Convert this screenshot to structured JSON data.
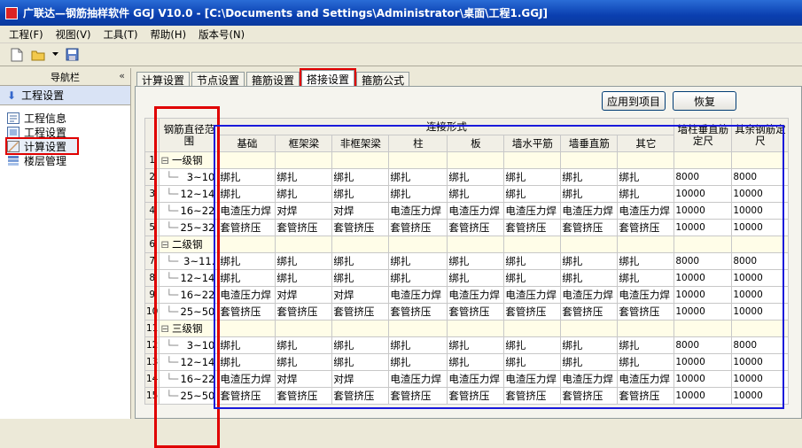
{
  "window": {
    "title": "广联达—钢筋抽样软件 GGJ V10.0 - [C:\\Documents and Settings\\Administrator\\桌面\\工程1.GGJ]"
  },
  "menu": [
    "工程(F)",
    "视图(V)",
    "工具(T)",
    "帮助(H)",
    "版本号(N)"
  ],
  "toolbar": {
    "icons": [
      "new-file-icon",
      "open-folder-icon",
      "dropdown-arrow-icon",
      "save-icon"
    ]
  },
  "nav": {
    "header": "导航栏",
    "collapse": "«",
    "group": "工程设置",
    "items": [
      {
        "label": "工程信息",
        "icon": "info-icon"
      },
      {
        "label": "工程设置",
        "icon": "settings-icon"
      },
      {
        "label": "计算设置",
        "icon": "calc-icon"
      },
      {
        "label": "楼层管理",
        "icon": "floors-icon"
      }
    ]
  },
  "tabs": [
    "计算设置",
    "节点设置",
    "箍筋设置",
    "搭接设置",
    "箍筋公式"
  ],
  "buttons": {
    "apply": "应用到项目",
    "restore": "恢复"
  },
  "grid": {
    "headers": {
      "range": "钢筋直径范围",
      "connection": "连接形式",
      "cols": [
        "基础",
        "框架梁",
        "非框架梁",
        "柱",
        "板",
        "墙水平筋",
        "墙垂直筋",
        "其它"
      ],
      "wall_fixed": "墙柱垂直筋定尺",
      "other_fixed": "其余钢筋定尺"
    },
    "rows": [
      {
        "n": "1",
        "group": true,
        "label": "一级钢",
        "vals": [
          "",
          "",
          "",
          "",
          "",
          "",
          "",
          ""
        ],
        "wall": "",
        "other": ""
      },
      {
        "n": "2",
        "label": "3~10",
        "vals": [
          "绑扎",
          "绑扎",
          "绑扎",
          "绑扎",
          "绑扎",
          "绑扎",
          "绑扎",
          "绑扎"
        ],
        "wall": "8000",
        "other": "8000"
      },
      {
        "n": "3",
        "label": "12~14",
        "vals": [
          "绑扎",
          "绑扎",
          "绑扎",
          "绑扎",
          "绑扎",
          "绑扎",
          "绑扎",
          "绑扎"
        ],
        "wall": "10000",
        "other": "10000"
      },
      {
        "n": "4",
        "label": "16~22",
        "vals": [
          "电渣压力焊",
          "对焊",
          "对焊",
          "电渣压力焊",
          "电渣压力焊",
          "电渣压力焊",
          "电渣压力焊",
          "电渣压力焊"
        ],
        "wall": "10000",
        "other": "10000"
      },
      {
        "n": "5",
        "label": "25~32",
        "vals": [
          "套管挤压",
          "套管挤压",
          "套管挤压",
          "套管挤压",
          "套管挤压",
          "套管挤压",
          "套管挤压",
          "套管挤压"
        ],
        "wall": "10000",
        "other": "10000"
      },
      {
        "n": "6",
        "group": true,
        "label": "二级钢",
        "vals": [
          "",
          "",
          "",
          "",
          "",
          "",
          "",
          ""
        ],
        "wall": "",
        "other": ""
      },
      {
        "n": "7",
        "label": "3~11.",
        "vals": [
          "绑扎",
          "绑扎",
          "绑扎",
          "绑扎",
          "绑扎",
          "绑扎",
          "绑扎",
          "绑扎"
        ],
        "wall": "8000",
        "other": "8000"
      },
      {
        "n": "8",
        "label": "12~14",
        "vals": [
          "绑扎",
          "绑扎",
          "绑扎",
          "绑扎",
          "绑扎",
          "绑扎",
          "绑扎",
          "绑扎"
        ],
        "wall": "10000",
        "other": "10000"
      },
      {
        "n": "9",
        "label": "16~22",
        "vals": [
          "电渣压力焊",
          "对焊",
          "对焊",
          "电渣压力焊",
          "电渣压力焊",
          "电渣压力焊",
          "电渣压力焊",
          "电渣压力焊"
        ],
        "wall": "10000",
        "other": "10000"
      },
      {
        "n": "10",
        "label": "25~50",
        "vals": [
          "套管挤压",
          "套管挤压",
          "套管挤压",
          "套管挤压",
          "套管挤压",
          "套管挤压",
          "套管挤压",
          "套管挤压"
        ],
        "wall": "10000",
        "other": "10000"
      },
      {
        "n": "11",
        "group": true,
        "label": "三级钢",
        "vals": [
          "",
          "",
          "",
          "",
          "",
          "",
          "",
          ""
        ],
        "wall": "",
        "other": ""
      },
      {
        "n": "12",
        "label": "3~10",
        "vals": [
          "绑扎",
          "绑扎",
          "绑扎",
          "绑扎",
          "绑扎",
          "绑扎",
          "绑扎",
          "绑扎"
        ],
        "wall": "8000",
        "other": "8000"
      },
      {
        "n": "13",
        "label": "12~14",
        "vals": [
          "绑扎",
          "绑扎",
          "绑扎",
          "绑扎",
          "绑扎",
          "绑扎",
          "绑扎",
          "绑扎"
        ],
        "wall": "10000",
        "other": "10000"
      },
      {
        "n": "14",
        "label": "16~22",
        "vals": [
          "电渣压力焊",
          "对焊",
          "对焊",
          "电渣压力焊",
          "电渣压力焊",
          "电渣压力焊",
          "电渣压力焊",
          "电渣压力焊"
        ],
        "wall": "10000",
        "other": "10000"
      },
      {
        "n": "15",
        "label": "25~50",
        "vals": [
          "套管挤压",
          "套管挤压",
          "套管挤压",
          "套管挤压",
          "套管挤压",
          "套管挤压",
          "套管挤压",
          "套管挤压"
        ],
        "wall": "10000",
        "other": "10000"
      }
    ]
  },
  "colors": {
    "highlight_red": "#e00000",
    "highlight_blue": "#1a1adb",
    "title_blue": "#0a3fb0"
  }
}
